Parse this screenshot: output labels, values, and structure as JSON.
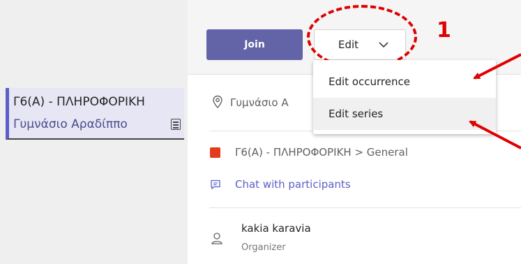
{
  "event_chip": {
    "title": "Γ6(Α) - ΠΛΗΡΟΦΟΡΙΚΗ",
    "subtitle": "Γυμνάσιο Αραδίππο"
  },
  "toolbar": {
    "join_label": "Join",
    "edit_label": "Edit"
  },
  "annotation": {
    "step_number": "1",
    "color": "#e00000"
  },
  "edit_menu": {
    "items": [
      {
        "label": "Edit occurrence"
      },
      {
        "label": "Edit series"
      }
    ]
  },
  "details": {
    "location": "Γυμνάσιο Α",
    "channel": "Γ6(Α) - ΠΛΗΡΟΦΟΡΙΚΗ > General",
    "chat_link": "Chat with participants",
    "organizer_name": "kakia karavia",
    "organizer_role": "Organizer"
  },
  "icons": {
    "location": "location-pin-icon",
    "channel": "team-channel-icon",
    "chat": "chat-icon",
    "person": "person-icon",
    "chevron": "chevron-down-icon",
    "notes": "notes-icon"
  },
  "colors": {
    "accent": "#6264a7",
    "link": "#5b5fc7",
    "channel_badge": "#e33b1c"
  }
}
